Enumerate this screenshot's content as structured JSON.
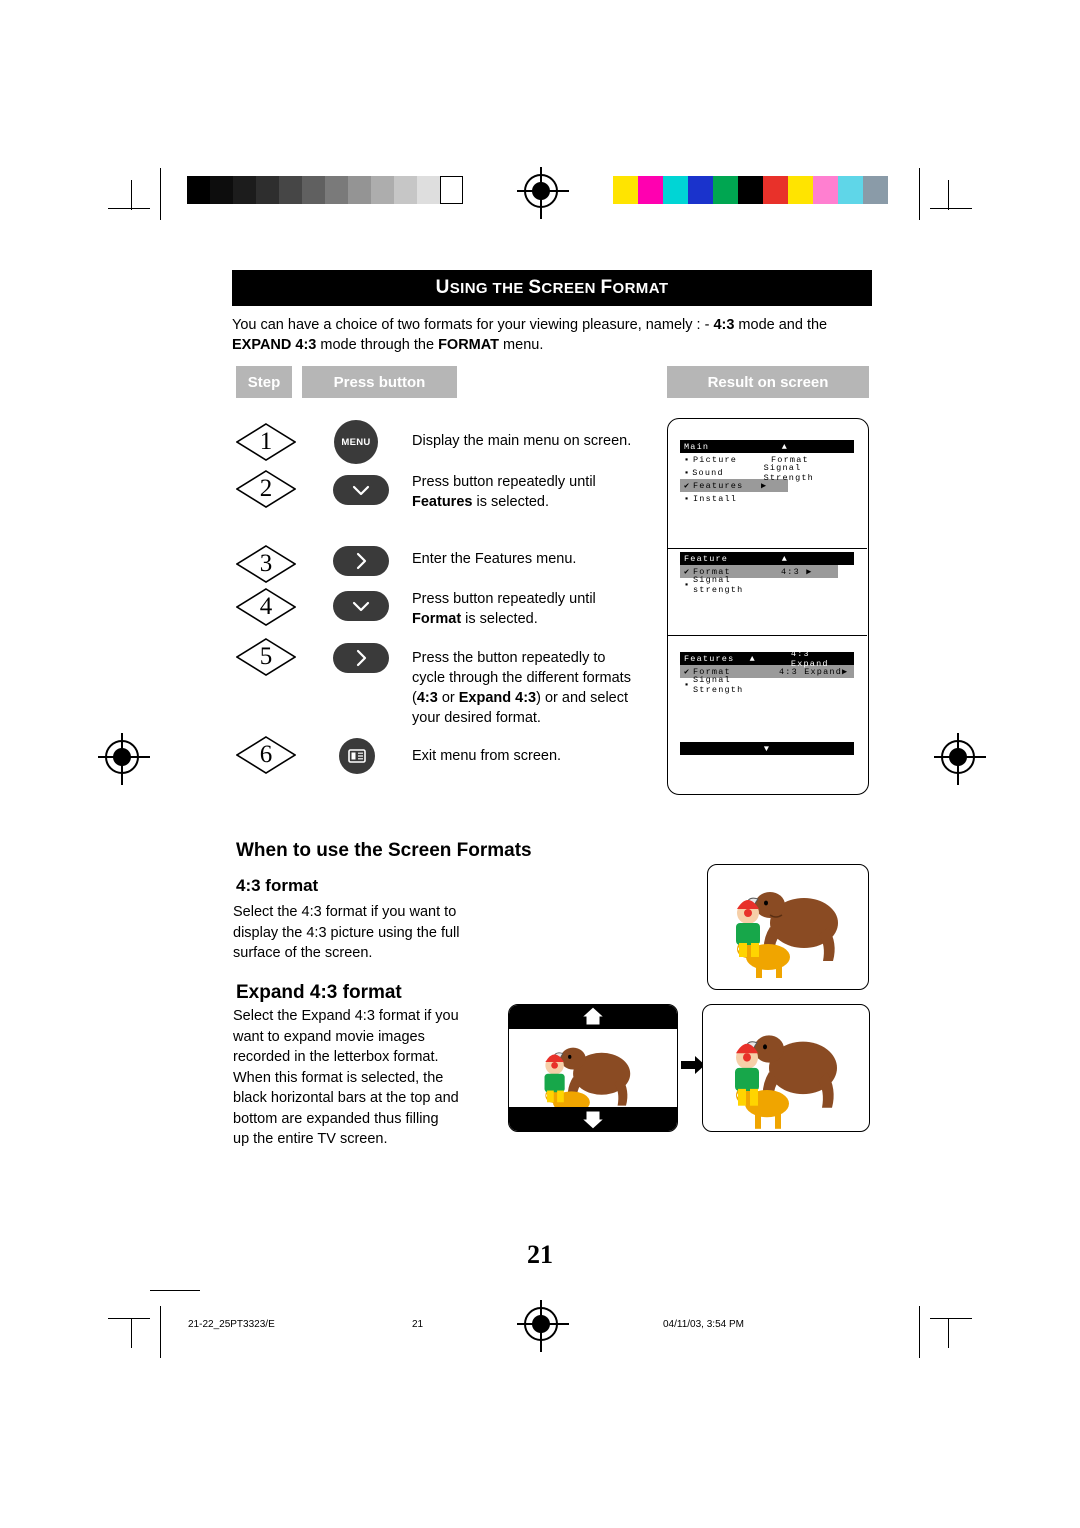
{
  "header": {
    "title_caps": "U",
    "title": "USING THE SCREEN FORMAT",
    "title_parts": [
      "U",
      "SING THE ",
      "S",
      "CREEN ",
      "F",
      "ORMAT"
    ]
  },
  "intro": {
    "line1_a": "You can have a choice of two formats for your viewing pleasure, namely : - ",
    "line1_b": "4:3",
    "line1_c": " mode and the",
    "line2_a": "EXPAND 4:3",
    "line2_b": " mode through the ",
    "line2_c": "FORMAT",
    "line2_d": " menu."
  },
  "table_head": {
    "step": "Step",
    "press_button": "Press button",
    "result": "Result on screen"
  },
  "steps": [
    {
      "num": "1",
      "button": "MENU",
      "button_type": "round-text",
      "desc": "Display the main menu on screen."
    },
    {
      "num": "2",
      "button": "▽",
      "button_type": "pill",
      "desc_a": "Press button repeatedly until",
      "desc_b": "Features",
      "desc_c": " is selected."
    },
    {
      "num": "3",
      "button": "❯",
      "button_type": "pill",
      "desc": "Enter the Features menu."
    },
    {
      "num": "4",
      "button": "▽",
      "button_type": "pill",
      "desc_a": "Press button repeatedly until",
      "desc_b": "Format",
      "desc_c": " is selected."
    },
    {
      "num": "5",
      "button": "❯",
      "button_type": "pill",
      "desc_a": "Press the button repeatedly to",
      "desc_b": "cycle through the different formats",
      "desc_c1": "(",
      "desc_c2": "4:3",
      "desc_c3": " or ",
      "desc_c4": "Expand 4:3",
      "desc_c5": ") or and select",
      "desc_d": "your desired format."
    },
    {
      "num": "6",
      "button": "icon",
      "button_type": "small-icon",
      "desc": "Exit menu from screen."
    }
  ],
  "osd": {
    "menu1": {
      "title": "Main",
      "up_arrow": "▲",
      "rows": [
        {
          "bullet": "▪",
          "left": "Picture",
          "right": "Format",
          "selected": false
        },
        {
          "bullet": "▪",
          "left": "Sound",
          "right": "Signal Strength",
          "selected": false
        },
        {
          "bullet": "✔",
          "left": "Features",
          "right": "▶",
          "selected": true
        },
        {
          "bullet": "▪",
          "left": "Install",
          "right": "",
          "selected": false
        }
      ]
    },
    "menu2": {
      "title": "Feature",
      "up_arrow": "▲",
      "rows": [
        {
          "bullet": "✔",
          "left": "Format",
          "right": "4:3  ▶",
          "selected": true
        },
        {
          "bullet": "▪",
          "left": "Signal strength",
          "right": "",
          "selected": false
        }
      ]
    },
    "menu3": {
      "title": "Features",
      "up_arrow": "▲",
      "header_right": "4:3 Expand",
      "rows": [
        {
          "bullet": "✔",
          "left": "Format",
          "right": "4:3 Expand▶",
          "selected": true
        },
        {
          "bullet": "▪",
          "left": "Signal Strength",
          "right": "",
          "selected": false
        }
      ],
      "down_arrow": "▼"
    }
  },
  "sections": {
    "when_to_use": "When to use the Screen Formats",
    "fmt43_head": "4:3 format",
    "fmt43_text": "Select the 4:3 format if you want to\ndisplay the 4:3 picture using the full\nsurface of the screen.",
    "expand_head": "Expand 4:3 format",
    "expand_text": "Select the Expand 4:3 format if you\nwant to expand movie images\nrecorded in the letterbox format.\nWhen this format is selected, the\nblack horizontal bars at the top and\nbottom are expanded thus filling\nup the entire TV screen."
  },
  "footer": {
    "page_number": "21",
    "left": "21-22_25PT3323/E",
    "center": "21",
    "right": "04/11/03, 3:54 PM"
  },
  "swatches": {
    "gray": [
      "#000000",
      "#0d0d0d",
      "#1c1c1c",
      "#2e2e2e",
      "#464646",
      "#606060",
      "#7a7a7a",
      "#949494",
      "#adadad",
      "#c6c6c6",
      "#dedede",
      "#ffffff"
    ],
    "color": [
      "#ffe400",
      "#ff00b0",
      "#00d5d5",
      "#1a33cc",
      "#00a651",
      "#000000",
      "#e8312a",
      "#ffe400",
      "#ff7fd0",
      "#5fd6e8",
      "#8a9ba8"
    ]
  }
}
